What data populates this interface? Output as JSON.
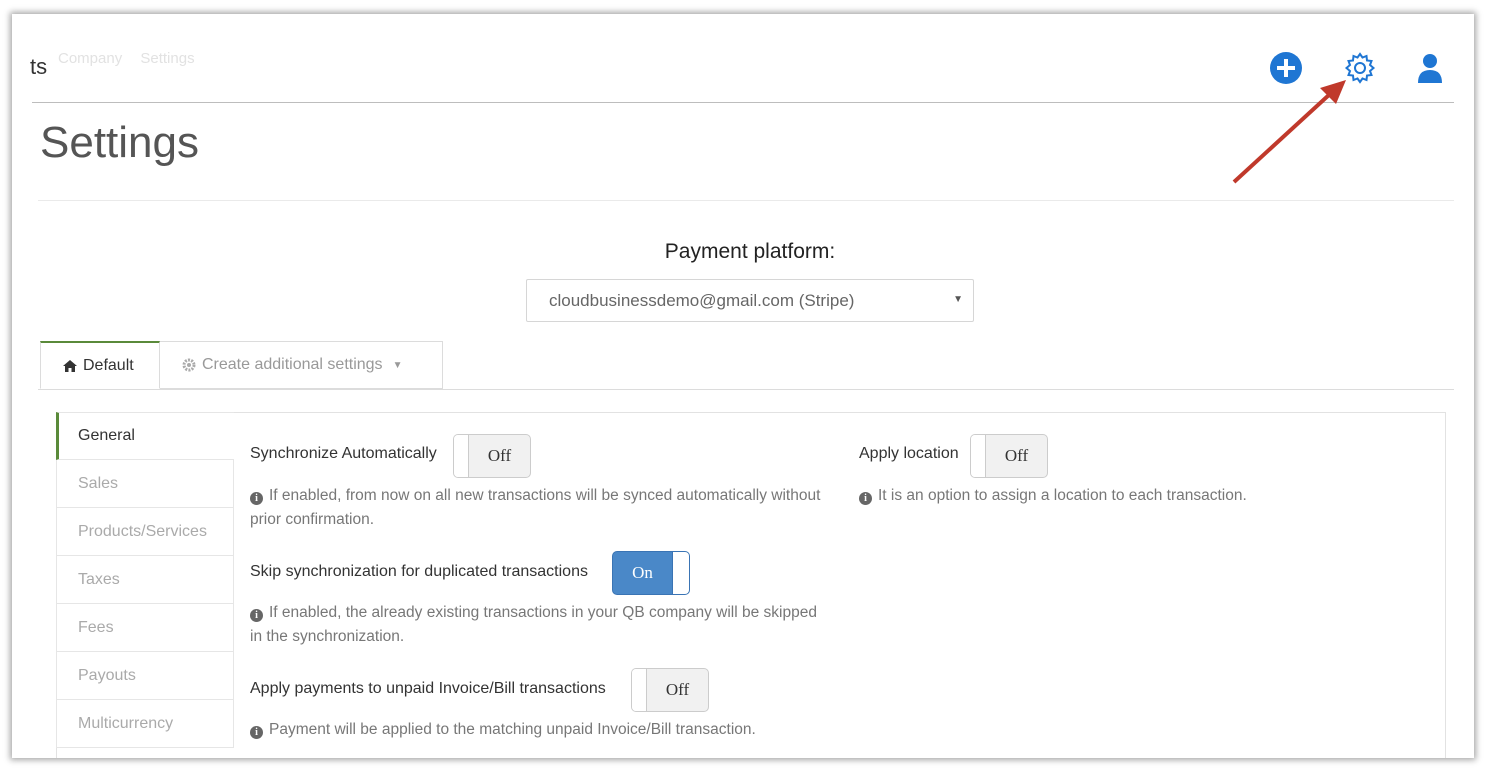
{
  "header": {
    "crumb_prefix": "ts",
    "crumb_company": "Company",
    "crumb_settings": "Settings",
    "icons": [
      "plus-circle-icon",
      "gear-icon",
      "user-icon"
    ],
    "accent_color": "#1f76d3"
  },
  "page_title": "Settings",
  "payment_platform": {
    "label": "Payment platform:",
    "selected": "cloudbusinessdemo@gmail.com (Stripe)"
  },
  "tabs": [
    {
      "label": "Default",
      "icon": "home-icon",
      "active": true
    },
    {
      "label": "Create additional settings",
      "icon": "gear-icon",
      "active": false
    }
  ],
  "sidebar": {
    "items": [
      {
        "label": "General",
        "active": true
      },
      {
        "label": "Sales"
      },
      {
        "label": "Products/Services"
      },
      {
        "label": "Taxes"
      },
      {
        "label": "Fees"
      },
      {
        "label": "Payouts"
      },
      {
        "label": "Multicurrency"
      }
    ]
  },
  "settings": {
    "sync_auto": {
      "label": "Synchronize Automatically",
      "state": "Off",
      "help": "If enabled, from now on all new transactions will be synced automatically without prior confirmation."
    },
    "skip_dup": {
      "label": "Skip synchronization for duplicated transactions",
      "state": "On",
      "help": "If enabled, the already existing transactions in your QB company will be skipped in the synchronization."
    },
    "apply_payments": {
      "label": "Apply payments to unpaid Invoice/Bill transactions",
      "state": "Off",
      "help": "Payment will be applied to the matching unpaid Invoice/Bill transaction."
    },
    "apply_location": {
      "label": "Apply location",
      "state": "Off",
      "help": "It is an option to assign a location to each transaction."
    }
  },
  "annotation_arrow_color": "#c0392b"
}
